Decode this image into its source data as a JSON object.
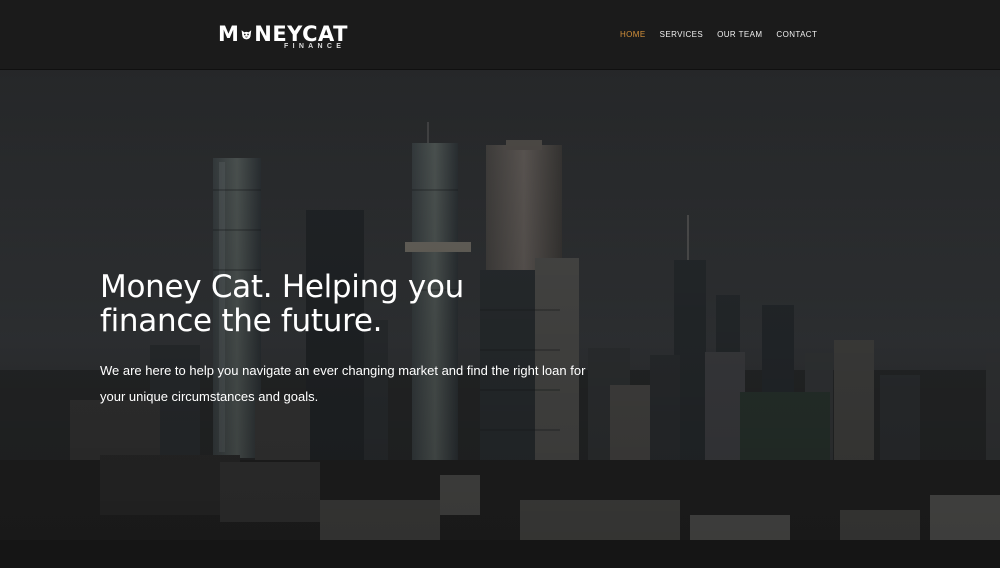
{
  "brand": {
    "name": "MONEYCAT",
    "name_part1": "M",
    "name_part2": "NEYCAT",
    "tagline": "FINANCE"
  },
  "nav": {
    "items": [
      {
        "label": "HOME",
        "active": true
      },
      {
        "label": "SERVICES",
        "active": false
      },
      {
        "label": "OUR TEAM",
        "active": false
      },
      {
        "label": "CONTACT",
        "active": false
      }
    ]
  },
  "hero": {
    "title_line1": "Money Cat. Helping you",
    "title_line2": "finance the future.",
    "subtitle": "We are here to help you navigate an ever changing market and find the right loan for your unique circumstances and goals."
  },
  "colors": {
    "header_bg": "#1b1b1b",
    "nav_active": "#d4913a",
    "text": "#ffffff"
  }
}
